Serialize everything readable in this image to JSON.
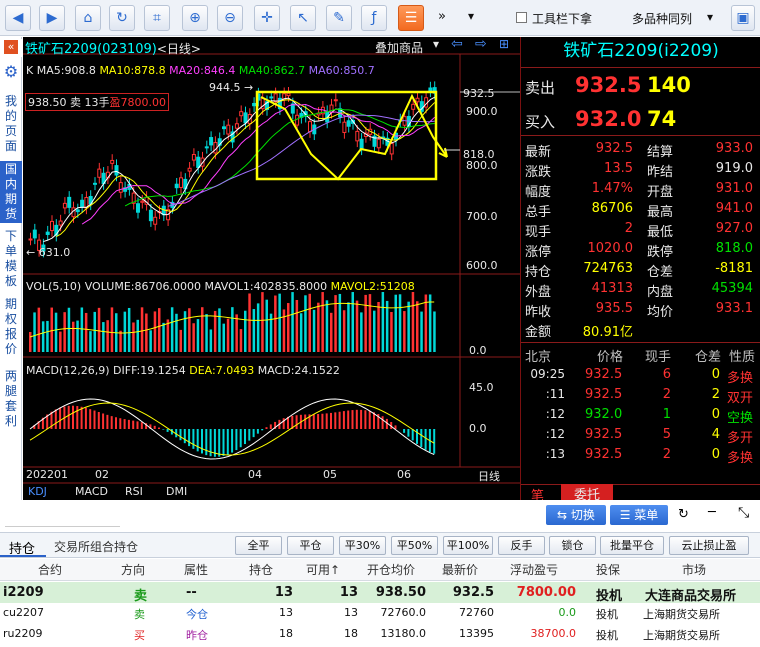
{
  "toolbar": {
    "show_toolbar_label": "工具栏下拿",
    "multi_label": "多品种同列",
    "more": "»"
  },
  "sidebar": {
    "items": [
      "我的页面",
      "国内期货",
      "下单模板",
      "期权报价",
      "两腿套利"
    ]
  },
  "chart": {
    "title": "铁矿石2209(023109)",
    "period": "<日线>",
    "overlay": "叠加商品",
    "ma_line": {
      "k": "K",
      "ma5": "MA5:908.8",
      "ma10": "MA10:878.8",
      "ma20": "MA20:846.4",
      "ma40": "MA40:862.7",
      "ma60": "MA60:850.7"
    },
    "trade_label": {
      "price": "938.50",
      "side": "卖",
      "qty": "13手",
      "pnl": "盈7800.00"
    },
    "high_mark": "944.5",
    "low_mark": "631.0",
    "y_ticks": [
      "932.5",
      "900.0",
      "818.0",
      "800.0",
      "700.0",
      "600.0"
    ],
    "vol_line": {
      "vol": "VOL(5,10)",
      "volume": "VOLUME:86706.0000",
      "mavol1": "MAVOL1:402835.8000",
      "mavol2": "MAVOL2:51208"
    },
    "vol_tick": "0.0",
    "macd_line": {
      "macd": "MACD(12,26,9)",
      "diff": "DIFF:19.1254",
      "dea": "DEA:7.0493",
      "macdv": "MACD:24.1522"
    },
    "macd_ticks": [
      "45.0",
      "0.0"
    ],
    "x_labels": [
      "202201",
      "02",
      "04",
      "05",
      "06"
    ],
    "period_label": "日线",
    "indicator_tabs": [
      "KDJ",
      "MACD",
      "RSI",
      "DMI"
    ]
  },
  "quote": {
    "name": "铁矿石2209(i2209)",
    "sell_label": "卖出",
    "sell_price": "932.5",
    "sell_qty": "140",
    "buy_label": "买入",
    "buy_price": "932.0",
    "buy_qty": "74",
    "rows": [
      {
        "l1": "最新",
        "v1": "932.5",
        "l2": "结算",
        "v2": "933.0"
      },
      {
        "l1": "涨跌",
        "v1": "13.5",
        "l2": "昨结",
        "v2": "919.0"
      },
      {
        "l1": "幅度",
        "v1": "1.47%",
        "l2": "开盘",
        "v2": "931.0"
      },
      {
        "l1": "总手",
        "v1": "86706",
        "l2": "最高",
        "v2": "941.0"
      },
      {
        "l1": "现手",
        "v1": "2",
        "l2": "最低",
        "v2": "927.0"
      },
      {
        "l1": "涨停",
        "v1": "1020.0",
        "l2": "跌停",
        "v2": "818.0"
      },
      {
        "l1": "持仓",
        "v1": "724763",
        "l2": "仓差",
        "v2": "-8181"
      },
      {
        "l1": "外盘",
        "v1": "41313",
        "l2": "内盘",
        "v2": "45394"
      },
      {
        "l1": "昨收",
        "v1": "935.5",
        "l2": "均价",
        "v2": "933.1"
      },
      {
        "l1": "金额",
        "v1": "80.91亿",
        "l2": "",
        "v2": ""
      }
    ],
    "tick_headers": [
      "北京",
      "价格",
      "现手",
      "仓差",
      "性质"
    ],
    "ticks": [
      {
        "time": "09:25",
        "price": "932.5",
        "qty": "6",
        "diff": "0",
        "type": "多换"
      },
      {
        "time": ":11",
        "price": "932.5",
        "qty": "2",
        "diff": "2",
        "type": "双开"
      },
      {
        "time": ":12",
        "price": "932.0",
        "qty": "1",
        "diff": "0",
        "type": "空换"
      },
      {
        "time": ":12",
        "price": "932.5",
        "qty": "5",
        "diff": "4",
        "type": "多开"
      },
      {
        "time": ":13",
        "price": "932.5",
        "qty": "2",
        "diff": "0",
        "type": "多换"
      }
    ],
    "tabs": [
      "笔",
      "委托"
    ]
  },
  "bottom": {
    "switch": "切换",
    "menu": "菜单",
    "tabs": [
      "持仓",
      "交易所组合持仓"
    ],
    "buttons": [
      "全平",
      "平仓",
      "平30%",
      "平50%",
      "平100%",
      "反手",
      "锁仓",
      "批量平仓",
      "云止损止盈"
    ],
    "headers": [
      "合约",
      "方向",
      "属性",
      "持仓",
      "可用↑",
      "开仓均价",
      "最新价",
      "浮动盈亏",
      "投保",
      "市场"
    ],
    "rows": [
      {
        "c": "i2209",
        "d": "卖",
        "a": "--",
        "p": "13",
        "u": "13",
        "o": "938.50",
        "n": "932.5",
        "f": "7800.00",
        "t": "投机",
        "m": "大连商品交易所"
      },
      {
        "c": "cu2207",
        "d": "卖",
        "a": "今仓",
        "p": "13",
        "u": "13",
        "o": "72760.0",
        "n": "72760",
        "f": "0.0",
        "t": "投机",
        "m": "上海期货交易所"
      },
      {
        "c": "ru2209",
        "d": "买",
        "a": "昨仓",
        "p": "18",
        "u": "18",
        "o": "13180.0",
        "n": "13395",
        "f": "38700.0",
        "t": "投机",
        "m": "上海期货交易所"
      }
    ]
  }
}
